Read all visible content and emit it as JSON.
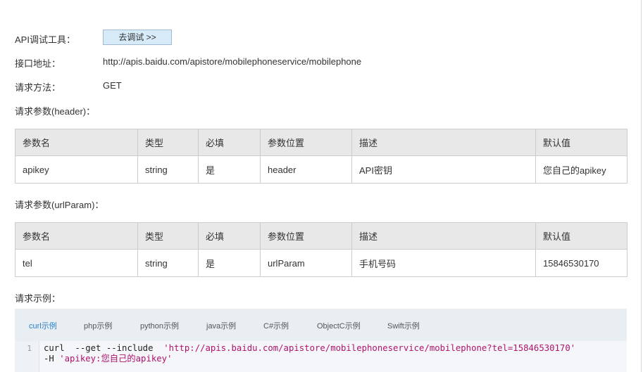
{
  "api_tool": {
    "label": "API调试工具：",
    "button_label": "去调试 >>"
  },
  "endpoint": {
    "label": "接口地址：",
    "value": "http://apis.baidu.com/apistore/mobilephoneservice/mobilephone"
  },
  "method": {
    "label": "请求方法：",
    "value": "GET"
  },
  "header_params": {
    "label": "请求参数(header)：",
    "columns": [
      "参数名",
      "类型",
      "必填",
      "参数位置",
      "描述",
      "默认值"
    ],
    "rows": [
      [
        "apikey",
        "string",
        "是",
        "header",
        "API密钥",
        "您自己的apikey"
      ]
    ]
  },
  "url_params": {
    "label": "请求参数(urlParam)：",
    "columns": [
      "参数名",
      "类型",
      "必填",
      "参数位置",
      "描述",
      "默认值"
    ],
    "rows": [
      [
        "tel",
        "string",
        "是",
        "urlParam",
        "手机号码",
        "15846530170"
      ]
    ]
  },
  "examples": {
    "label": "请求示例：",
    "tabs": [
      "curl示例",
      "php示例",
      "python示例",
      "java示例",
      "C#示例",
      "ObjectC示例",
      "Swift示例"
    ],
    "active_tab": "curl示例",
    "code": {
      "line_number": "1",
      "line1_cmd": "curl  --get --include  ",
      "line1_str": "'http://apis.baidu.com/apistore/mobilephoneservice/mobilephone?tel=15846530170'",
      "line2_cmd": "-H ",
      "line2_str": "'apikey:您自己的apikey'"
    }
  },
  "colors": {
    "button_bg": "#d6eaf8",
    "table_header_bg": "#e8e8e8",
    "code_panel_bg": "#e9eef3",
    "active_tab": "#2a7fc9",
    "code_string": "#b0126d"
  }
}
